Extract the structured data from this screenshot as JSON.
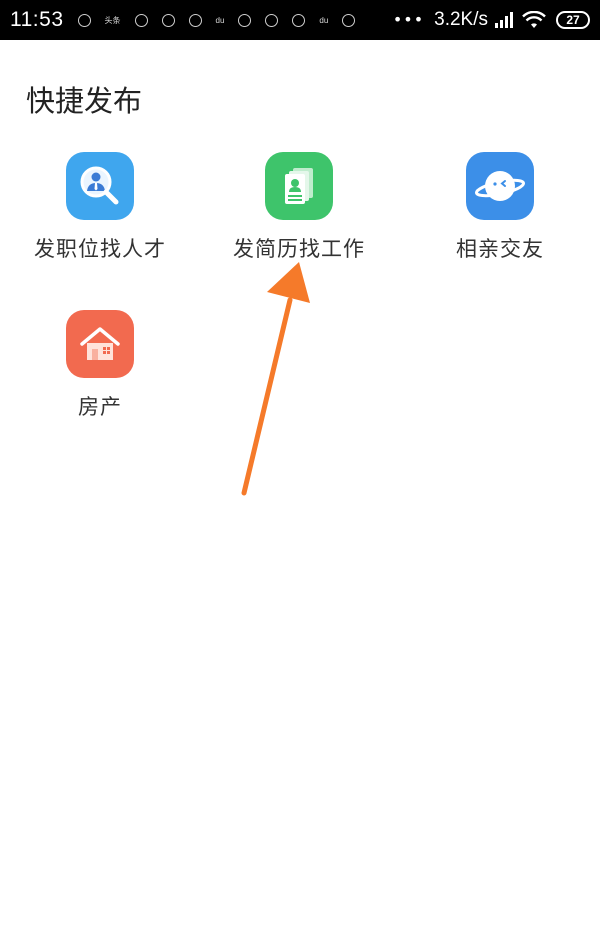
{
  "status_bar": {
    "time": "11:53",
    "notification_icons": [
      "circle-icon",
      "toutiao-text-icon",
      "circle-icon",
      "circle-icon",
      "circle-icon",
      "du-text-icon",
      "circle-icon",
      "circle-icon",
      "circle-icon",
      "du-text-icon",
      "circle-icon"
    ],
    "toutiao_text": "头条",
    "du_text": "du",
    "more_dots": "•••",
    "network_speed": "3.2K/s",
    "battery_level": "27"
  },
  "page": {
    "title": "快捷发布"
  },
  "quick_publish_items": [
    {
      "label": "发职位找人才",
      "icon": "recruit-search-icon",
      "color": "#3fa6ee"
    },
    {
      "label": "发简历找工作",
      "icon": "resume-icon",
      "color": "#3ec46b"
    },
    {
      "label": "相亲交友",
      "icon": "planet-icon",
      "color": "#3c8fe8"
    },
    {
      "label": "房产",
      "icon": "house-icon",
      "color": "#f26a4f"
    }
  ],
  "annotation": {
    "arrow_color": "#f57a2a"
  }
}
